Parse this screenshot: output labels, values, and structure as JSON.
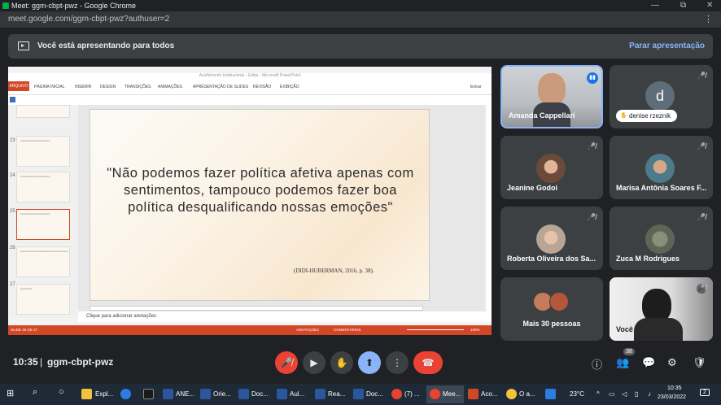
{
  "browser": {
    "title": "Meet: ggm-cbpt-pwz - Google Chrome",
    "url": "meet.google.com/ggm-cbpt-pwz?authuser=2",
    "controls": {
      "minimize": "—",
      "restore": "⧉",
      "close": "✕"
    }
  },
  "banner": {
    "text": "Você está apresentando para todos",
    "stop_label": "Parar apresentação"
  },
  "powerpoint": {
    "title": "Acolhimento Institucional - Editar - Microsoft PowerPoint",
    "file_tab": "ARQUIVO",
    "tabs": [
      "PÁGINA INICIAL",
      "INSERIR",
      "DESIGN",
      "TRANSIÇÕES",
      "ANIMAÇÕES",
      "APRESENTAÇÃO DE SLIDES",
      "REVISÃO",
      "EXIBIÇÃO"
    ],
    "signin": "Entrar",
    "slide_numbers": [
      "23",
      "24",
      "25",
      "26",
      "27"
    ],
    "quote": "\"Não podemos fazer política afetiva apenas com sentimentos, tampouco podemos fazer boa política desqualificando nossas emoções\"",
    "citation": "(DIDI-HUBERMAN, 2016, p. 38).",
    "notes_placeholder": "Clique para adicionar anotações",
    "status_left": "SLIDE 25 DE 27",
    "status_notes": "ANOTAÇÕES",
    "status_comments": "COMENTÁRIOS",
    "zoom": "100%"
  },
  "participants": [
    {
      "name": "Amanda Cappellari",
      "speaking": true
    },
    {
      "name": "denise rzeznik",
      "initial": "d",
      "muted": true
    },
    {
      "name": "Jeanine Godoi",
      "muted": true
    },
    {
      "name": "Marisa Antônia Soares F...",
      "muted": true
    },
    {
      "name": "Roberta Oliveira dos Sa...",
      "muted": true
    },
    {
      "name": "Zuca M Rodrigues",
      "muted": true
    },
    {
      "name": "Mais 30 pessoas"
    },
    {
      "name": "Você",
      "muted": true
    }
  ],
  "bottom_bar": {
    "time": "10:35",
    "meeting_code": "ggm-cbpt-pwz",
    "participant_count": "38"
  },
  "taskbar": {
    "apps": [
      "Expl...",
      "ANE...",
      "Orie...",
      "Doc...",
      "Doc...",
      "Aul...",
      "Rea...",
      "Doc...",
      "(7) ...",
      "Mee...",
      "Aco...",
      "O a..."
    ],
    "temperature": "23°C",
    "clock_time": "10:35",
    "clock_date": "23/03/2022",
    "notifications": "2"
  },
  "colors": {
    "ppt_accent": "#d24726",
    "meet_bg": "#202124",
    "tile_bg": "#3c4043",
    "hangup": "#ea4335",
    "link": "#8ab4f8"
  }
}
